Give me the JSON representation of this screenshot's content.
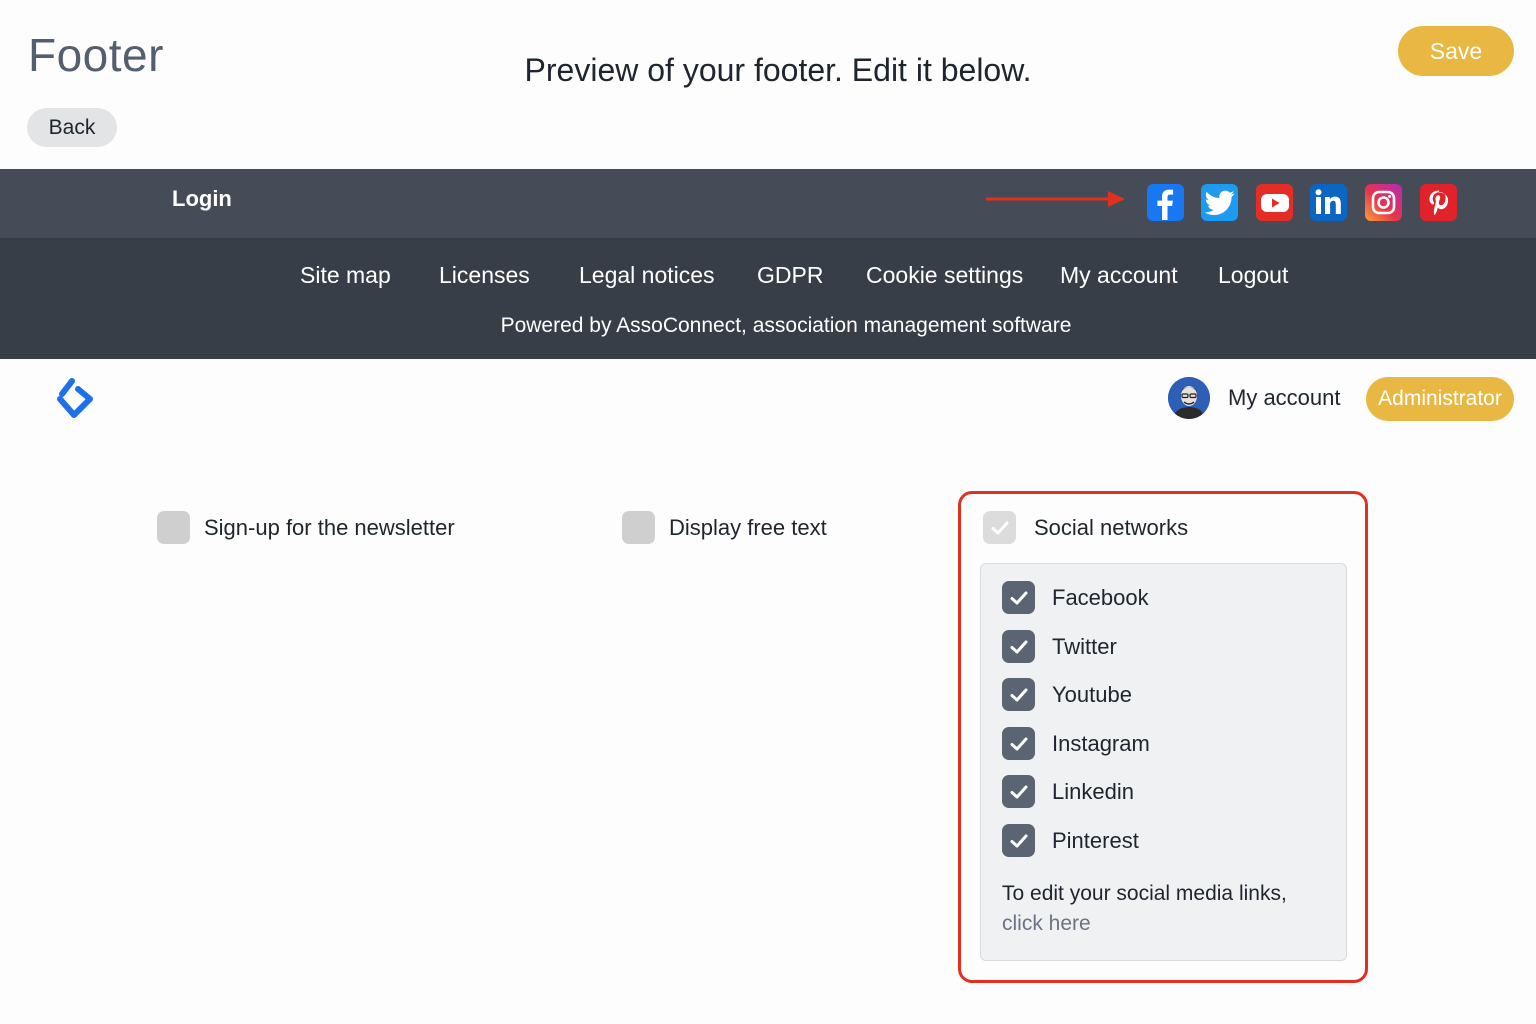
{
  "header": {
    "page_title": "Footer",
    "preview_heading": "Preview of your footer. Edit it below.",
    "back_label": "Back",
    "save_label": "Save",
    "accent_color": "#e9b842"
  },
  "footer_preview": {
    "login_label": "Login",
    "social_icons": [
      "facebook-icon",
      "twitter-icon",
      "youtube-icon",
      "linkedin-icon",
      "instagram-icon",
      "pinterest-icon"
    ],
    "nav_links": [
      "Site map",
      "Licenses",
      "Legal notices",
      "GDPR",
      "Cookie settings",
      "My account",
      "Logout"
    ],
    "powered_by": "Powered by AssoConnect, association management software",
    "colors": {
      "top_bar": "#454c57",
      "bottom_bar": "#383e48"
    }
  },
  "user_bar": {
    "my_account_label": "My account",
    "role_badge": "Administrator"
  },
  "options": {
    "newsletter": {
      "label": "Sign-up for the newsletter",
      "checked": false
    },
    "free_text": {
      "label": "Display free text",
      "checked": false
    },
    "social_networks": {
      "label": "Social networks",
      "checked": true,
      "networks": [
        {
          "label": "Facebook",
          "checked": true
        },
        {
          "label": "Twitter",
          "checked": true
        },
        {
          "label": "Youtube",
          "checked": true
        },
        {
          "label": "Instagram",
          "checked": true
        },
        {
          "label": "Linkedin",
          "checked": true
        },
        {
          "label": "Pinterest",
          "checked": true
        }
      ],
      "edit_note": "To edit your social media links,",
      "edit_link": "click here"
    }
  }
}
